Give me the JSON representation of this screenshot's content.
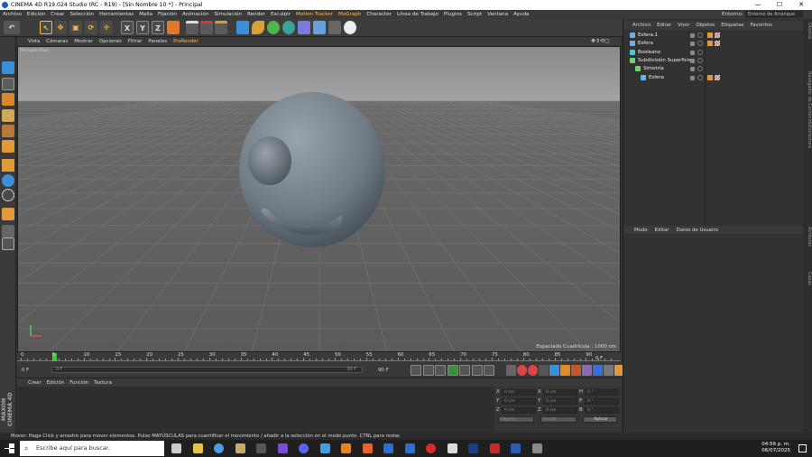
{
  "window": {
    "title": "CINEMA 4D R19.024 Studio (RC - R19) - [Sin Nombre 10 *] - Principal",
    "minimize": "—",
    "maximize": "☐",
    "close": "✕"
  },
  "menubar": [
    "Archivo",
    "Edición",
    "Crear",
    "Selección",
    "Herramientas",
    "Malla",
    "Fijación",
    "Animación",
    "Simulación",
    "Render",
    "Esculpir",
    "Motion Tracker",
    "MoGraph",
    "Character",
    "Línea de Trabajo",
    "Plugins",
    "Script",
    "Ventana",
    "Ayuda"
  ],
  "environment": {
    "label": "Entorno:",
    "value": "Entorno de Arranque"
  },
  "toolbar": {
    "axis_x": "X",
    "axis_y": "Y",
    "axis_z": "Z"
  },
  "viewport": {
    "menu": [
      "Vista",
      "Cámaras",
      "Mostrar",
      "Opciones",
      "Filtrar",
      "Paneles",
      "ProRender"
    ],
    "camera_label": "Perspectiva",
    "grid_label": "Espaciado Cuadrícula : 1000 cm"
  },
  "timeline": {
    "ticks": [
      "0",
      "5",
      "10",
      "15",
      "20",
      "25",
      "30",
      "35",
      "40",
      "45",
      "50",
      "55",
      "60",
      "65",
      "70",
      "75",
      "80",
      "85",
      "90"
    ],
    "end_frame_label": "0 F",
    "current_frame": "0 F",
    "start_field": "0 F",
    "end_field": "90 F",
    "max_field": "90 F"
  },
  "material_menu": [
    "Crear",
    "Edición",
    "Función",
    "Textura"
  ],
  "coords": {
    "rows": [
      {
        "a": "X",
        "av": "0 cm",
        "b": "X",
        "bv": "0 cm",
        "c": "H",
        "cv": "0 °"
      },
      {
        "a": "Y",
        "av": "0 cm",
        "b": "Y",
        "bv": "0 cm",
        "c": "P",
        "cv": "0 °"
      },
      {
        "a": "Z",
        "av": "0 cm",
        "b": "Z",
        "bv": "0 cm",
        "c": "B",
        "cv": "0 °"
      }
    ],
    "mode1": "Objeto",
    "mode2": "Escala",
    "apply": "Aplicar"
  },
  "object_menu": [
    "Archivo",
    "Editar",
    "Visor",
    "Objetos",
    "Etiquetas",
    "Favoritos"
  ],
  "objects": [
    {
      "name": "Esfera.1",
      "indent": 0,
      "icon_color": "#6ab0e6"
    },
    {
      "name": "Esfera",
      "indent": 0,
      "icon_color": "#6ab0e6"
    },
    {
      "name": "Booleano",
      "indent": 0,
      "icon_color": "#5bc0de"
    },
    {
      "name": "Subdivisión Superficie",
      "indent": 0,
      "icon_color": "#6fd36f"
    },
    {
      "name": "Simetría",
      "indent": 1,
      "icon_color": "#6fd36f"
    },
    {
      "name": "Esfera",
      "indent": 2,
      "icon_color": "#6ab0e6"
    }
  ],
  "attr_menu": [
    "Modo",
    "Editar",
    "Datos de Usuario"
  ],
  "right_tabs": [
    "Objetos",
    "Navegador de Contenido",
    "Estructura",
    "Atributos",
    "Capas"
  ],
  "status": "Mover: Haga Click y arrastre para mover elementos. Pulse MAYÚSCULAS para cuantificar el movimiento / añadir a la selección en el modo punto. CTRL para restar.",
  "taskbar": {
    "search_placeholder": "Escribe aquí para buscar.",
    "time": "04:56 p. m.",
    "date": "06/07/2025"
  },
  "brand": "MAXON CINEMA 4D",
  "colors": {
    "accent": "#ffb84a",
    "sphere": "#6f7a83"
  }
}
